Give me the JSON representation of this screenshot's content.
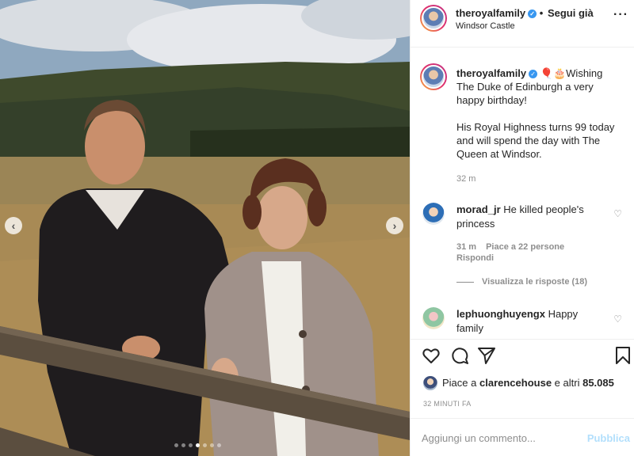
{
  "photo": {
    "alt_icon": "photo-carousel",
    "prev_glyph": "‹",
    "next_glyph": "›",
    "carousel_dots": 7,
    "active_dot": 3
  },
  "header": {
    "username": "theroyalfamily",
    "verified_glyph": "✓",
    "separator": "•",
    "follow_label": "Segui già",
    "location": "Windsor Castle",
    "more_glyph": "···"
  },
  "caption": {
    "username": "theroyalfamily",
    "emoji": "🎈🎂",
    "line1": "Wishing The Duke of Edinburgh a very happy birthday!",
    "line2": "His Royal Highness turns 99 today and will spend the day with The Queen at Windsor.",
    "time": "32 m"
  },
  "comments": [
    {
      "username": "morad_jr",
      "text": "He killed people's princess",
      "time": "31 m",
      "likes": "Piace a 22 persone",
      "reply_label": "Rispondi",
      "view_replies": "Visualizza le risposte (18)"
    },
    {
      "username": "lephuonghuyengx",
      "text": "Happy family"
    }
  ],
  "actions": {
    "likes_prefix": "Piace a",
    "likes_user": "clarencehouse",
    "likes_suffix": "e altri",
    "likes_count": "85.085",
    "time_ago": "32 MINUTI FA"
  },
  "comment_box": {
    "placeholder": "Aggiungi un commento...",
    "publish_label": "Pubblica"
  },
  "colors": {
    "verified": "#3897f0",
    "publish_disabled": "#b2dffc",
    "muted": "#8e8e8e"
  }
}
